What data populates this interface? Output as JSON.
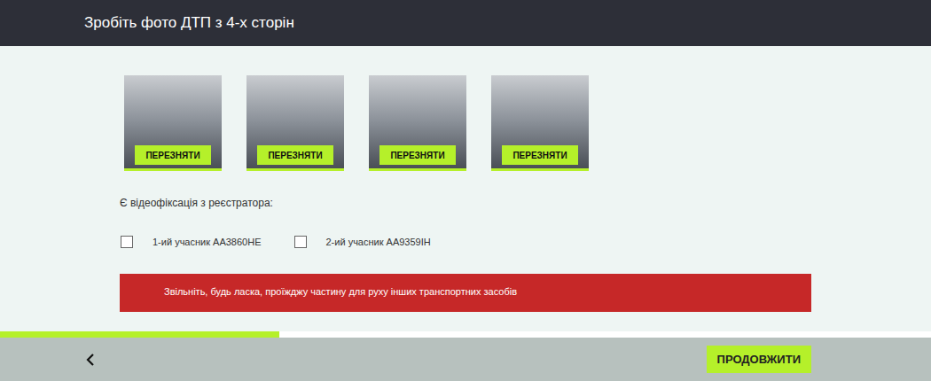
{
  "header": {
    "title": "Зробіть фото ДТП з 4-х сторін"
  },
  "photos": [
    {
      "button": "ПЕРЕЗНЯТИ"
    },
    {
      "button": "ПЕРЕЗНЯТИ"
    },
    {
      "button": "ПЕРЕЗНЯТИ"
    },
    {
      "button": "ПЕРЕЗНЯТИ"
    }
  ],
  "video": {
    "label": "Є відеофіксація з реєстратора:",
    "participants": [
      {
        "label": "1-ий учасник АА3860НЕ",
        "checked": false
      },
      {
        "label": "2-ий учасник АА9359ІН",
        "checked": false
      }
    ]
  },
  "alert": {
    "text": "Звільніть, будь ласка, проїжджу частину для руху інших транспортних засобів"
  },
  "progress": {
    "level": 0.3
  },
  "footer": {
    "continue": "ПРОДОВЖИТИ"
  }
}
